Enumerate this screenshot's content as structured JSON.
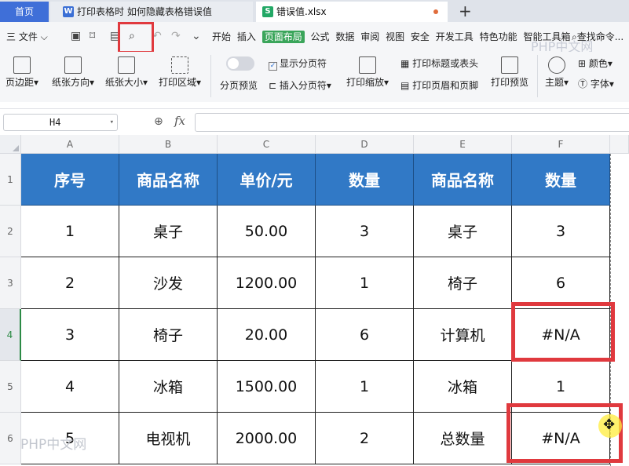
{
  "tabs": {
    "home": "首页",
    "doc1_icon": "W",
    "doc1": "打印表格时 如何隐藏表格错误值",
    "doc2_icon": "S",
    "doc2": "错误值.xlsx",
    "new_tab": "+"
  },
  "menubar": {
    "file": "三 文件 ⌵",
    "items": [
      "开始",
      "插入",
      "页面布局",
      "公式",
      "数据",
      "审阅",
      "视图",
      "安全",
      "开发工具",
      "特色功能",
      "智能工具箱"
    ],
    "search": "查找命令...",
    "watermark": "PHP中文网"
  },
  "ribbon": {
    "margins": "页边距▾",
    "orientation": "纸张方向▾",
    "size": "纸张大小▾",
    "print_area": "打印区域▾",
    "page_break_preview": "分页预览",
    "show_page_breaks": "显示分页符",
    "insert_page_break": "插入分页符▾",
    "print_scale": "打印缩放▾",
    "print_titles": "打印标题或表头",
    "header_footer": "打印页眉和页脚",
    "print_preview": "打印预览",
    "theme": "主题▾",
    "colors": "颜色▾",
    "fonts": "字体▾"
  },
  "formula_bar": {
    "name_box": "H4",
    "fx": "fx",
    "value": ""
  },
  "grid": {
    "columns": [
      "A",
      "B",
      "C",
      "D",
      "E",
      "F"
    ],
    "row_numbers": [
      "1",
      "2",
      "3",
      "4",
      "5",
      "6"
    ],
    "selected_row": "4",
    "header": [
      "序号",
      "商品名称",
      "单价/元",
      "数量",
      "商品名称",
      "数量"
    ],
    "rows": [
      [
        "1",
        "桌子",
        "50.00",
        "3",
        "桌子",
        "3"
      ],
      [
        "2",
        "沙发",
        "1200.00",
        "1",
        "椅子",
        "6"
      ],
      [
        "3",
        "椅子",
        "20.00",
        "6",
        "计算机",
        "#N/A"
      ],
      [
        "4",
        "冰箱",
        "1500.00",
        "1",
        "冰箱",
        "1"
      ],
      [
        "5",
        "电视机",
        "2000.00",
        "2",
        "总数量",
        "#N/A"
      ]
    ],
    "watermark": "PHP中文网"
  },
  "colors": {
    "header_fill": "#3179c6",
    "highlight": "#e0393e",
    "active_menu": "#3aa55a"
  }
}
